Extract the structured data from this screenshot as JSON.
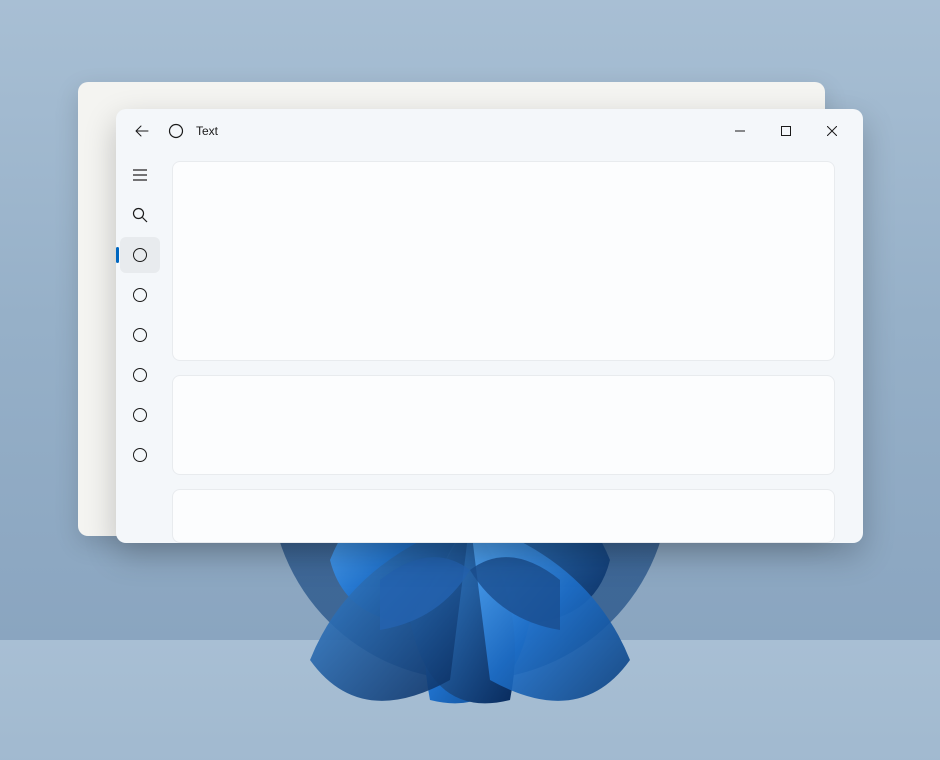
{
  "titlebar": {
    "title": "Text"
  },
  "nav": {
    "items": [
      {
        "id": "hamburger",
        "selected": false
      },
      {
        "id": "search",
        "selected": false
      },
      {
        "id": "item-1",
        "selected": true
      },
      {
        "id": "item-2",
        "selected": false
      },
      {
        "id": "item-3",
        "selected": false
      },
      {
        "id": "item-4",
        "selected": false
      },
      {
        "id": "item-5",
        "selected": false
      },
      {
        "id": "item-6",
        "selected": false
      }
    ]
  }
}
